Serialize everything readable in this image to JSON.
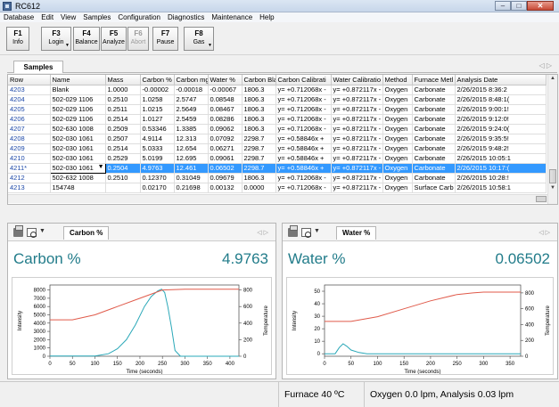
{
  "window": {
    "title": "RC612",
    "min": "–",
    "max": "□",
    "close": "✕"
  },
  "menu": [
    "Database",
    "Edit",
    "View",
    "Samples",
    "Configuration",
    "Diagnostics",
    "Maintenance",
    "Help"
  ],
  "toolbar": [
    {
      "key": "F1",
      "label": "Info",
      "enabled": true
    },
    {
      "key": "F3",
      "label": "Login",
      "enabled": true,
      "dropdown": true
    },
    {
      "key": "F4",
      "label": "Balance",
      "enabled": true
    },
    {
      "key": "F5",
      "label": "Analyze",
      "enabled": true
    },
    {
      "key": "F6",
      "label": "Abort",
      "enabled": false
    },
    {
      "key": "F7",
      "label": "Pause",
      "enabled": true
    },
    {
      "key": "F8",
      "label": "Gas",
      "enabled": true,
      "dropdown": true
    }
  ],
  "samples_tab": "Samples",
  "table": {
    "columns": [
      "Row",
      "Name",
      "Mass",
      "Carbon %",
      "Carbon mg",
      "Water %",
      "Carbon Blan",
      "Carbon Calibrati",
      "Water Calibratio",
      "Method",
      "Furnace Metl",
      "Analysis Date"
    ],
    "rows": [
      [
        "4203",
        "Blank",
        "1.0000",
        "-0.00002",
        "-0.00018",
        "-0.00067",
        "1806.3",
        "y= +0.712068x -",
        "y= +0.872117x -",
        "Oxygen",
        "Carbonate",
        "2/26/2015 8:36:2"
      ],
      [
        "4204",
        "502-029 1106",
        "0.2510",
        "1.0258",
        "2.5747",
        "0.08548",
        "1806.3",
        "y= +0.712068x -",
        "y= +0.872117x -",
        "Oxygen",
        "Carbonate",
        "2/26/2015 8:48:1("
      ],
      [
        "4205",
        "502-029 1106",
        "0.2511",
        "1.0215",
        "2.5649",
        "0.08467",
        "1806.3",
        "y= +0.712068x -",
        "y= +0.872117x -",
        "Oxygen",
        "Carbonate",
        "2/26/2015 9:00:1!"
      ],
      [
        "4206",
        "502-029 1106",
        "0.2514",
        "1.0127",
        "2.5459",
        "0.08286",
        "1806.3",
        "y= +0.712068x -",
        "y= +0.872117x -",
        "Oxygen",
        "Carbonate",
        "2/26/2015 9:12:0!"
      ],
      [
        "4207",
        "502-630 1008",
        "0.2509",
        "0.53346",
        "1.3385",
        "0.09062",
        "1806.3",
        "y= +0.712068x -",
        "y= +0.872117x -",
        "Oxygen",
        "Carbonate",
        "2/26/2015 9:24:0("
      ],
      [
        "4208",
        "502-030 1061",
        "0.2507",
        "4.9114",
        "12.313",
        "0.07092",
        "2298.7",
        "y= +0.58846x +",
        "y= +0.872117x -",
        "Oxygen",
        "Carbonate",
        "2/26/2015 9:35:5!"
      ],
      [
        "4209",
        "502-030 1061",
        "0.2514",
        "5.0333",
        "12.654",
        "0.06271",
        "2298.7",
        "y= +0.58846x +",
        "y= +0.872117x -",
        "Oxygen",
        "Carbonate",
        "2/26/2015 9:48:2!"
      ],
      [
        "4210",
        "502-030 1061",
        "0.2529",
        "5.0199",
        "12.695",
        "0.09061",
        "2298.7",
        "y= +0.58846x +",
        "y= +0.872117x -",
        "Oxygen",
        "Carbonate",
        "2/26/2015 10:05:1"
      ],
      [
        "4211*",
        "502-030 1061",
        "0.2504",
        "4.9763",
        "12.461",
        "0.06502",
        "2298.7",
        "y= +0.58846x +",
        "y= +0.872117x -",
        "Oxygen",
        "Carbonate",
        "2/26/2015 10:17:("
      ],
      [
        "4212",
        "502-632 1008",
        "0.2510",
        "0.12370",
        "0.31049",
        "0.09679",
        "1806.3",
        "y= +0.712068x -",
        "y= +0.872117x -",
        "Oxygen",
        "Carbonate",
        "2/26/2015 10:28:!"
      ],
      [
        "4213",
        "154748",
        "",
        "0.02170",
        "0.21698",
        "0.00132",
        "0.0000",
        "y= +0.712068x -",
        "y= +0.872117x -",
        "Oxygen",
        "Surface Carb",
        "2/26/2015 10:58:1"
      ]
    ],
    "selected_row": 8
  },
  "panels": [
    {
      "tab": "Carbon %",
      "label": "Carbon %",
      "value": "4.9763",
      "chart_data": {
        "type": "line",
        "xlabel": "Time (seconds)",
        "ylabel": "Intensity",
        "y2label": "Temperature",
        "x_ticks": [
          0,
          50,
          100,
          150,
          200,
          250,
          300,
          350,
          400
        ],
        "y_ticks": [
          0,
          1000,
          2000,
          3000,
          4000,
          5000,
          6000,
          7000,
          8000
        ],
        "y2_ticks": [
          0,
          200,
          400,
          600,
          800
        ],
        "xlim": [
          0,
          420
        ],
        "ylim": [
          0,
          8600
        ],
        "y2lim": [
          0,
          860
        ],
        "series": [
          {
            "color": "#2aa8b8",
            "axis": "left",
            "x": [
              0,
              50,
              100,
              130,
              150,
              170,
              190,
              210,
              225,
              240,
              248,
              255,
              262,
              270,
              278,
              290,
              420
            ],
            "y": [
              20,
              20,
              30,
              300,
              900,
              2000,
              3800,
              6000,
              7200,
              7900,
              8100,
              7700,
              6000,
              3500,
              700,
              0,
              0
            ]
          },
          {
            "color": "#e05a4a",
            "axis": "right",
            "x": [
              0,
              50,
              100,
              150,
              200,
              250,
              300,
              350,
              420
            ],
            "y": [
              440,
              440,
              500,
              600,
              700,
              800,
              810,
              810,
              810
            ]
          }
        ]
      }
    },
    {
      "tab": "Water %",
      "label": "Water %",
      "value": "0.06502",
      "chart_data": {
        "type": "line",
        "xlabel": "Time (seconds)",
        "ylabel": "Intensity",
        "y2label": "Temperature",
        "x_ticks": [
          0,
          50,
          100,
          150,
          200,
          250,
          300,
          350
        ],
        "y_ticks": [
          0,
          10,
          20,
          30,
          40,
          50
        ],
        "y2_ticks": [
          0,
          200,
          400,
          600,
          800
        ],
        "xlim": [
          0,
          370
        ],
        "ylim": [
          -2,
          55
        ],
        "y2lim": [
          0,
          900
        ],
        "series": [
          {
            "color": "#2aa8b8",
            "axis": "left",
            "x": [
              0,
              20,
              28,
              35,
              42,
              50,
              65,
              80,
              100,
              370
            ],
            "y": [
              0,
              0,
              5,
              8,
              6,
              3,
              1,
              0,
              0,
              0
            ]
          },
          {
            "color": "#e05a4a",
            "axis": "right",
            "x": [
              0,
              50,
              100,
              150,
              200,
              250,
              280,
              300,
              370
            ],
            "y": [
              440,
              440,
              500,
              600,
              700,
              780,
              800,
              810,
              810
            ]
          }
        ]
      }
    }
  ],
  "status": {
    "furnace": "Furnace 40 ºC",
    "gas": "Oxygen 0.0 lpm, Analysis 0.03 lpm"
  }
}
